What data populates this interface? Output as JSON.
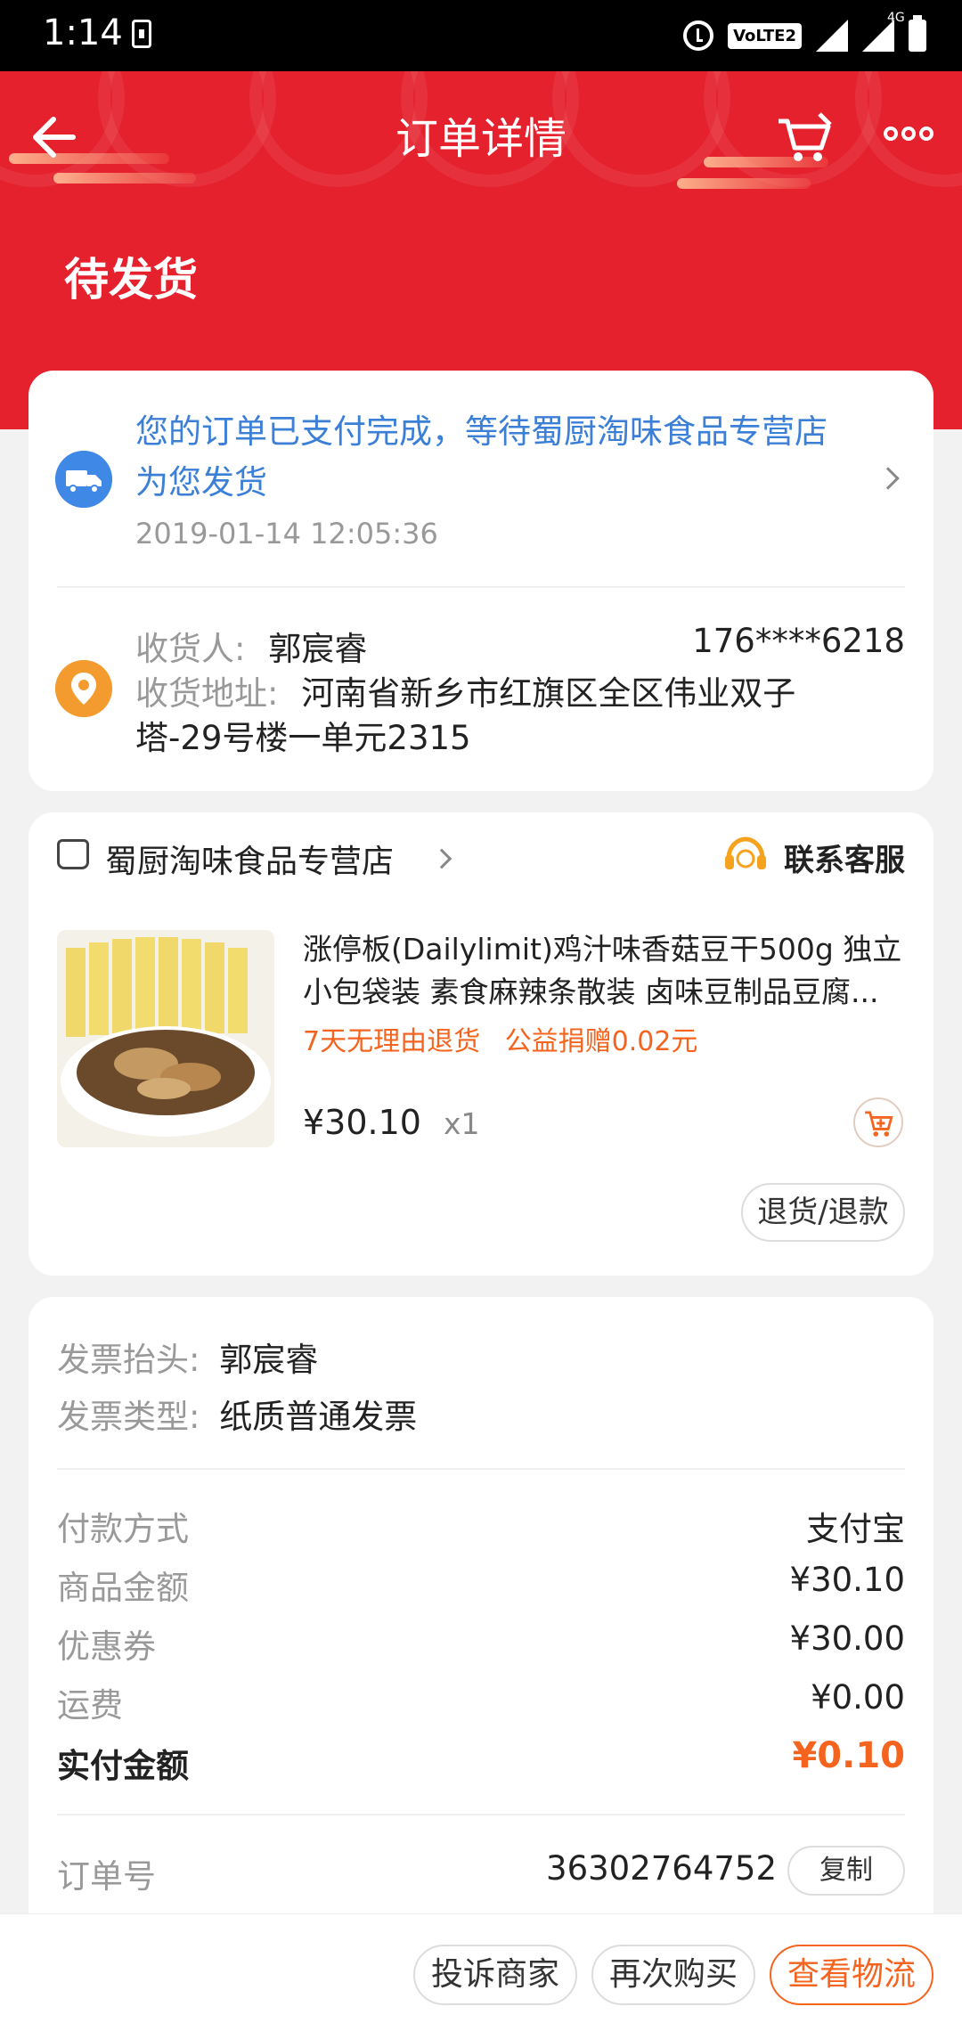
{
  "status_bar": {
    "time": "1:14",
    "network_badge": "VoLTE2",
    "network_type": "4G"
  },
  "header": {
    "title": "订单详情",
    "order_status": "待发货"
  },
  "shipping_notice": {
    "message": "您的订单已支付完成，等待蜀厨淘味食品专营店为您发货",
    "timestamp": "2019-01-14 12:05:36"
  },
  "recipient": {
    "name_label": "收货人:",
    "name": "郭宸睿",
    "phone": "176****6218",
    "address_label": "收货地址:",
    "address_line1": "河南省新乡市红旗区全区伟业双子",
    "address_line2": "塔-29号楼一单元2315"
  },
  "store": {
    "name": "蜀厨淘味食品专营店",
    "customer_service": "联系客服"
  },
  "product": {
    "name": "涨停板(Dailylimit)鸡汁味香菇豆干500g 独立小包袋装 素食麻辣条散装 卤味豆制品豆腐...",
    "tags": [
      "7天无理由退货",
      "公益捐赠0.02元"
    ],
    "price": "¥30.10",
    "quantity": "x1",
    "refund_button": "退货/退款"
  },
  "invoice": {
    "title_label": "发票抬头:",
    "title_value": "郭宸睿",
    "type_label": "发票类型:",
    "type_value": "纸质普通发票"
  },
  "payment": {
    "method_label": "付款方式",
    "method_value": "支付宝",
    "goods_label": "商品金额",
    "goods_value": "¥30.10",
    "coupon_label": "优惠券",
    "coupon_value": "¥30.00",
    "shipping_label": "运费",
    "shipping_value": "¥0.00",
    "paid_label": "实付金额",
    "paid_value": "¥0.10"
  },
  "order": {
    "number_label": "订单号",
    "number_value": "36302764752",
    "copy_button": "复制"
  },
  "actions": {
    "complain": "投诉商家",
    "buy_again": "再次购买",
    "logistics": "查看物流"
  },
  "colors": {
    "brand_red": "#e5212d",
    "accent_orange": "#f5641e",
    "link_blue": "#3b7fd6"
  }
}
